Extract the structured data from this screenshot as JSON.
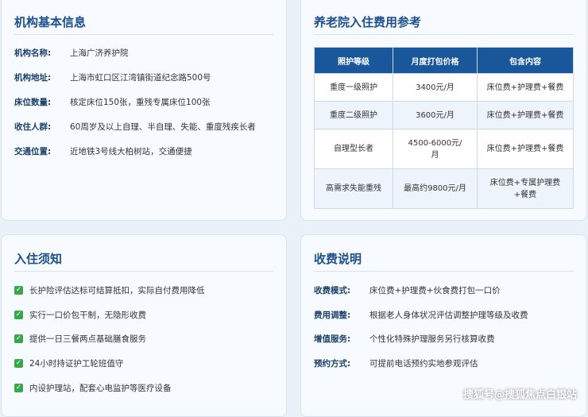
{
  "basic_info": {
    "title": "机构基本信息",
    "rows": [
      {
        "label": "机构名称:",
        "value": "上海广济养护院"
      },
      {
        "label": "机构地址:",
        "value": "上海市虹口区江湾镇街道纪念路500号"
      },
      {
        "label": "床位数量:",
        "value": "核定床位150张，重残专属床位100张"
      },
      {
        "label": "收住人群:",
        "value": "60周岁及以上自理、半自理、失能、重度残疾长者"
      },
      {
        "label": "交通位置:",
        "value": "近地铁3号线大柏树站，交通便捷"
      }
    ]
  },
  "fee_reference": {
    "title": "养老院入住费用参考",
    "headers": [
      "照护等级",
      "月度打包价格",
      "包含内容"
    ],
    "rows": [
      [
        "重度一级照护",
        "3400元/月",
        "床位费+护理费+餐费"
      ],
      [
        "重度二级照护",
        "3600元/月",
        "床位费+护理费+餐费"
      ],
      [
        "自理型长者",
        "4500-6000元/月",
        "床位费+护理费+餐费"
      ],
      [
        "高需求失能重残",
        "最高约9800元/月",
        "床位费+专属护理费+餐费"
      ]
    ]
  },
  "admission_notes": {
    "title": "入住须知",
    "items": [
      "长护险评估达标可结算抵扣，实际自付费用降低",
      "实行一口价包干制，无隐形收费",
      "提供一日三餐两点基础膳食服务",
      "24小时持证护工轮班值守",
      "内设护理站，配套心电监护等医疗设备"
    ]
  },
  "fee_explanation": {
    "title": "收费说明",
    "rows": [
      {
        "label": "收费模式:",
        "value": "床位费+护理费+伙食费打包一口价"
      },
      {
        "label": "费用调整:",
        "value": "根据老人身体状况评估调整护理等级及收费"
      },
      {
        "label": "增值服务:",
        "value": "个性化特殊护理服务另行核算收费"
      },
      {
        "label": "预约方式:",
        "value": "可提前电话预约实地参观评估"
      }
    ]
  },
  "watermark": "搜狐号@搜狐焦点白银站"
}
